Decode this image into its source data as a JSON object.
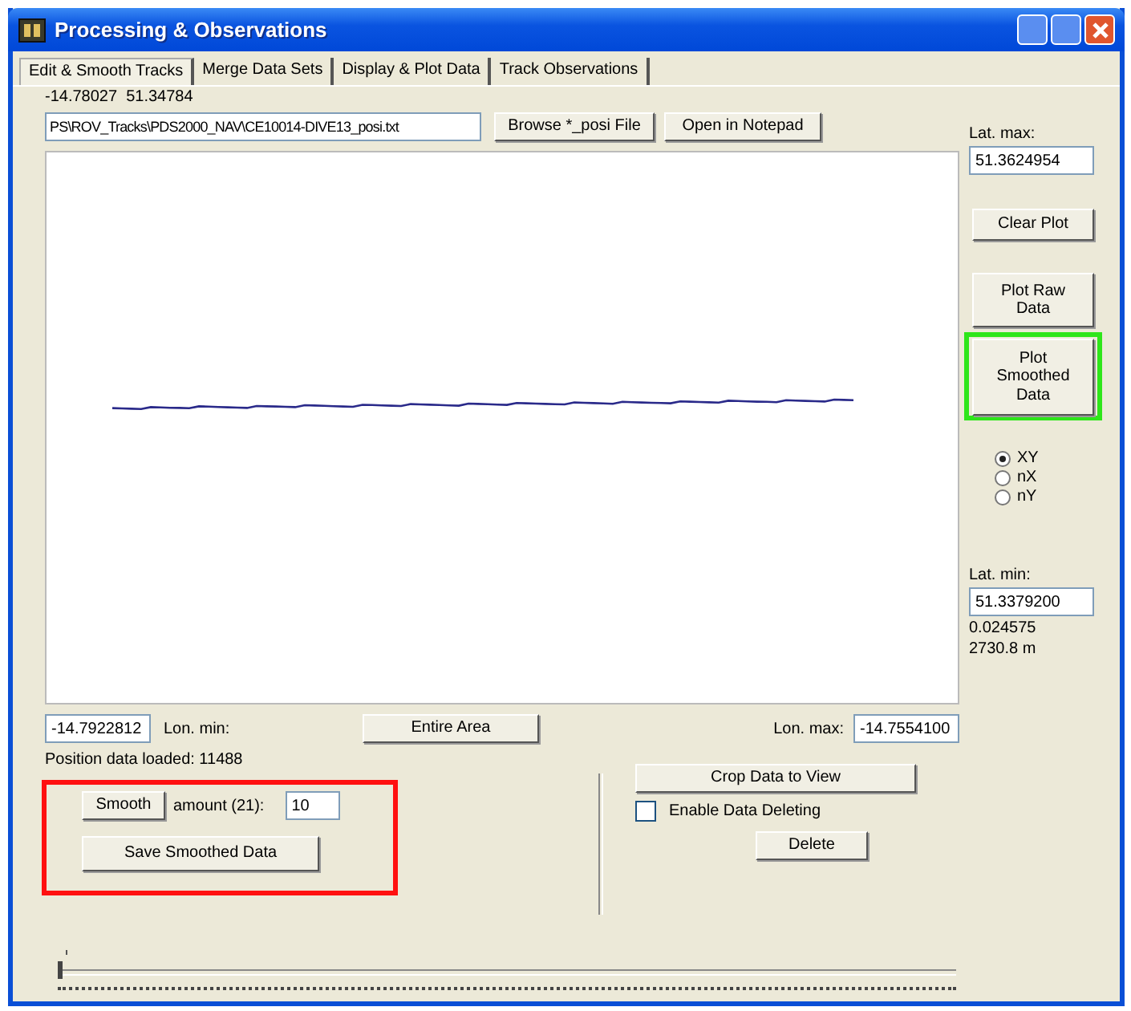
{
  "window": {
    "title": "Processing & Observations"
  },
  "tabs": [
    {
      "label": "Edit & Smooth Tracks",
      "selected": true
    },
    {
      "label": "Merge Data Sets",
      "selected": false
    },
    {
      "label": "Display & Plot Data",
      "selected": false
    },
    {
      "label": "Track Observations",
      "selected": false
    }
  ],
  "cursor_position": "-14.78027  51.34784",
  "file_path": {
    "value": "PS\\ROV_Tracks\\PDS2000_NAV\\CE10014-DIVE13_posi.txt"
  },
  "file_buttons": [
    "Browse *_posi File",
    "Open in Notepad"
  ],
  "lat_max": {
    "label": "Lat. max:",
    "value": "51.3624954"
  },
  "plot_buttons": [
    {
      "label": "Clear Plot",
      "highlighted": false
    },
    {
      "label": "Plot Raw\nData",
      "highlighted": false
    },
    {
      "label": "Plot\nSmoothed\nData",
      "highlighted": true
    }
  ],
  "axes": [
    {
      "label": "XY",
      "selected": true
    },
    {
      "label": "nX",
      "selected": false
    },
    {
      "label": "nY",
      "selected": false
    }
  ],
  "lat_min": {
    "label": "Lat. min:",
    "value": "51.3379200"
  },
  "span_readouts": [
    "0.024575",
    "2730.8 m"
  ],
  "lon_min": {
    "label": "Lon. min:",
    "value": "-14.7922812"
  },
  "entire_area_button": "Entire Area",
  "lon_max": {
    "label": "Lon. max:",
    "value": "-14.7554100"
  },
  "status": "Position data loaded: 11488",
  "smoothing": {
    "highlighted": true,
    "smooth_button": "Smooth",
    "amount_label": "amount (21):",
    "amount": "10",
    "save_button": "Save Smoothed Data"
  },
  "crop_button": "Crop Data to View",
  "enable_deleting": {
    "label": "Enable Data Deleting",
    "checked": false
  },
  "delete_button": "Delete",
  "position_slider": {
    "level": 0
  }
}
